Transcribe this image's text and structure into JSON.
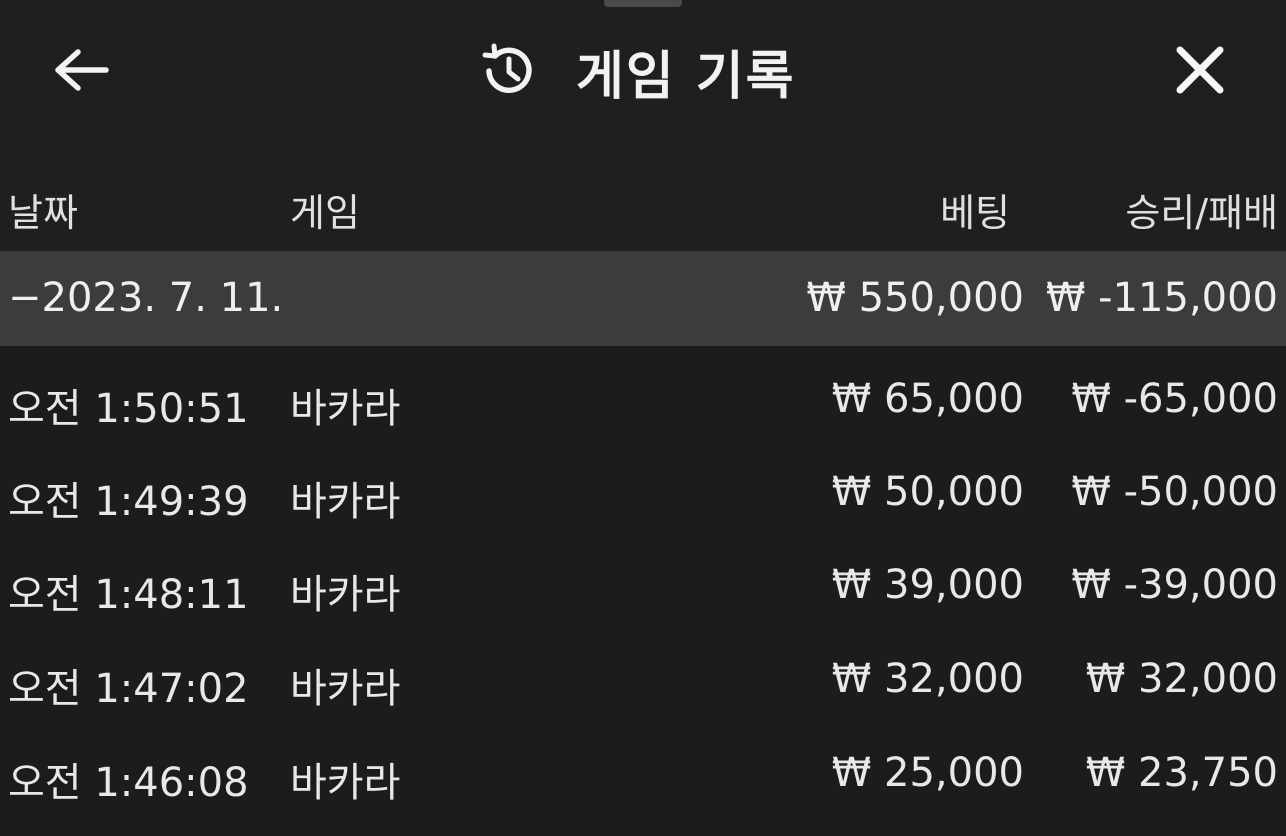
{
  "header": {
    "title": "게임 기록",
    "back_icon": "arrow-left-icon",
    "history_icon": "history-icon",
    "close_icon": "close-icon"
  },
  "columns": {
    "date": "날짜",
    "game": "게임",
    "bet": "베팅",
    "result": "승리/패배"
  },
  "summary": {
    "date": "−2023. 7. 11.",
    "bet": "₩ 550,000",
    "result": "₩ -115,000"
  },
  "rows": [
    {
      "time": "오전 1:50:51",
      "game": "바카라",
      "bet": "₩ 65,000",
      "result": "₩ -65,000"
    },
    {
      "time": "오전 1:49:39",
      "game": "바카라",
      "bet": "₩ 50,000",
      "result": "₩ -50,000"
    },
    {
      "time": "오전 1:48:11",
      "game": "바카라",
      "bet": "₩ 39,000",
      "result": "₩ -39,000"
    },
    {
      "time": "오전 1:47:02",
      "game": "바카라",
      "bet": "₩ 32,000",
      "result": "₩ 32,000"
    },
    {
      "time": "오전 1:46:08",
      "game": "바카라",
      "bet": "₩ 25,000",
      "result": "₩ 23,750"
    }
  ],
  "colors": {
    "background": "#1f1f1f",
    "summary_background": "#3c3c3c",
    "text": "#e8e8e8"
  }
}
